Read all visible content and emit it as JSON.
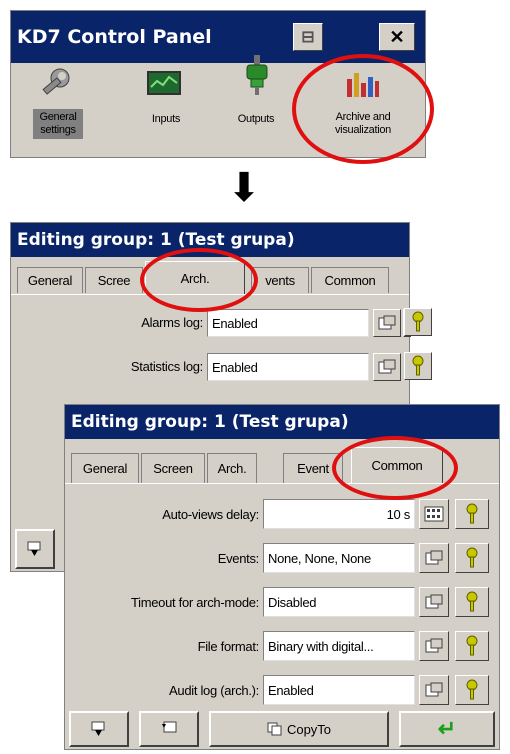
{
  "control_panel": {
    "title": "KD7 Control Panel",
    "minimize_glyph": "⊟",
    "close_glyph": "✕",
    "items": [
      {
        "label": "General settings",
        "icon": "wrench-icon"
      },
      {
        "label": "Inputs",
        "icon": "monitor-icon"
      },
      {
        "label": "Outputs",
        "icon": "plug-icon"
      },
      {
        "label": "Archive and visualization",
        "icon": "bar-chart-icon"
      }
    ],
    "item_label_lines": [
      [
        "General",
        "settings"
      ],
      [
        "Inputs"
      ],
      [
        "Outputs"
      ],
      [
        "Archive and",
        "visualization"
      ]
    ]
  },
  "arrow": {
    "glyph": "⬇"
  },
  "dialog_arch": {
    "title": "Editing group: 1 (Test grupa)",
    "tabs": [
      "General",
      "Screen",
      "Arch.",
      "Events",
      "Common"
    ],
    "tab_display": [
      "General",
      "Scree",
      "Arch.",
      "vents",
      "Common"
    ],
    "active_tab": "Arch.",
    "rows": [
      {
        "label": "Alarms log:",
        "value": "Enabled"
      },
      {
        "label": "Statistics log:",
        "value": "Enabled"
      }
    ]
  },
  "dialog_common": {
    "title": "Editing group: 1 (Test grupa)",
    "tabs": [
      "General",
      "Screen",
      "Arch.",
      "Events",
      "Common"
    ],
    "tab_display": [
      "General",
      "Screen",
      "Arch.",
      "Event",
      "Common"
    ],
    "active_tab": "Common",
    "rows": [
      {
        "label": "Auto-views delay:",
        "value": "10 s",
        "align": "right"
      },
      {
        "label": "Events:",
        "value": "None, None, None"
      },
      {
        "label": "Timeout for arch-mode:",
        "value": "Disabled"
      },
      {
        "label": "File format:",
        "value": "Binary with digital..."
      },
      {
        "label": "Audit log (arch.):",
        "value": "Enabled"
      }
    ],
    "bottom_bar": {
      "copy_label": "CopyTo",
      "copy_icon": "copy-icon",
      "enter_glyph": "↵"
    }
  },
  "colors": {
    "titlebar": "#0a246a",
    "highlight_circle": "#e01010",
    "panel": "#d4d0c8",
    "key_icon": "#c8c800",
    "enter_arrow": "#1aa01a"
  }
}
